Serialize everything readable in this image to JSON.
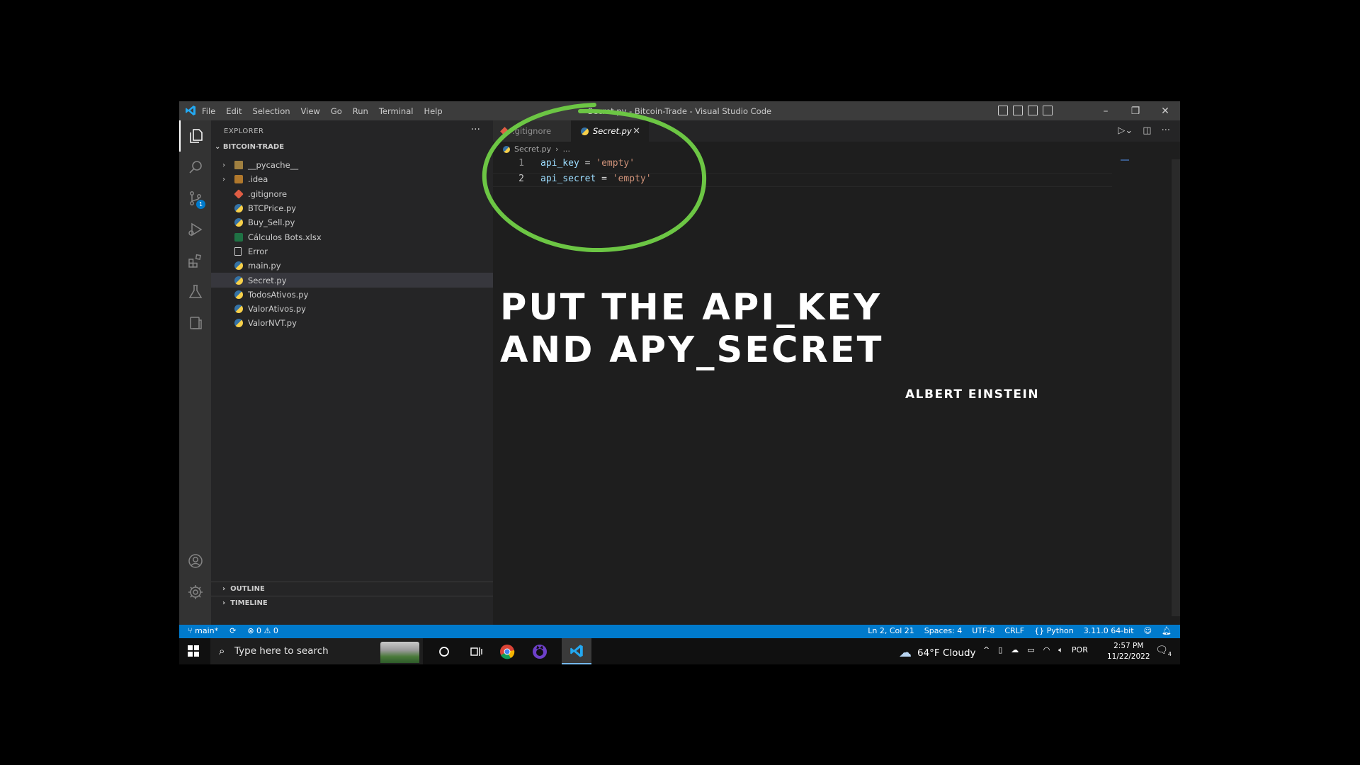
{
  "window": {
    "title": "Secret.py - Bitcoin-Trade - Visual Studio Code",
    "menu": [
      "File",
      "Edit",
      "Selection",
      "View",
      "Go",
      "Run",
      "Terminal",
      "Help"
    ],
    "controls": {
      "minimize": "–",
      "restore": "❐",
      "close": "✕"
    }
  },
  "activity_bar": {
    "items": [
      "explorer-icon",
      "search-icon",
      "source-control-icon",
      "run-debug-icon",
      "extensions-icon",
      "testing-icon",
      "remote-explorer-icon",
      "account-icon",
      "settings-gear-icon"
    ],
    "source_control_badge": "1"
  },
  "sidebar": {
    "header": "EXPLORER",
    "more": "···",
    "project": "BITCOIN-TRADE",
    "files": [
      {
        "name": "__pycache__",
        "type": "folder"
      },
      {
        "name": ".idea",
        "type": "folder"
      },
      {
        "name": ".gitignore",
        "type": "git"
      },
      {
        "name": "BTCPrice.py",
        "type": "py"
      },
      {
        "name": "Buy_Sell.py",
        "type": "py"
      },
      {
        "name": "Cálculos Bots.xlsx",
        "type": "xlsx"
      },
      {
        "name": "Error",
        "type": "file"
      },
      {
        "name": "main.py",
        "type": "py"
      },
      {
        "name": "Secret.py",
        "type": "py",
        "selected": true
      },
      {
        "name": "TodosAtivos.py",
        "type": "py"
      },
      {
        "name": "ValorAtivos.py",
        "type": "py"
      },
      {
        "name": "ValorNVT.py",
        "type": "py"
      }
    ],
    "outline": "OUTLINE",
    "timeline": "TIMELINE"
  },
  "editor": {
    "tabs": [
      {
        "label": ".gitignore",
        "active": false
      },
      {
        "label": "Secret.py",
        "active": true,
        "close": "✕"
      }
    ],
    "breadcrumb": [
      "Secret.py",
      "..."
    ],
    "lines": [
      {
        "num": "1",
        "var": "api_key",
        "op": " = ",
        "str": "'empty'"
      },
      {
        "num": "2",
        "var": "api_secret",
        "op": " = ",
        "str": "'empty'"
      }
    ]
  },
  "overlay": {
    "headline_line1": "PUT THE API_KEY",
    "headline_line2": "AND APY_SECRET",
    "author": "ALBERT EINSTEIN",
    "circle_color": "#6cc644"
  },
  "status_bar": {
    "branch": "main*",
    "errors": "0",
    "warnings": "0",
    "position": "Ln 2, Col 21",
    "spaces": "Spaces: 4",
    "encoding": "UTF-8",
    "eol": "CRLF",
    "language": "Python",
    "interpreter": "3.11.0 64-bit"
  },
  "taskbar": {
    "search_placeholder": "Type here to search",
    "weather": "64°F  Cloudy",
    "language": "POR",
    "time": "2:57 PM",
    "date": "11/22/2022",
    "notifications": "4"
  },
  "colors": {
    "accent": "#007acc",
    "editor_bg": "#1e1e1e",
    "sidebar_bg": "#252526",
    "annotation": "#6cc644"
  }
}
